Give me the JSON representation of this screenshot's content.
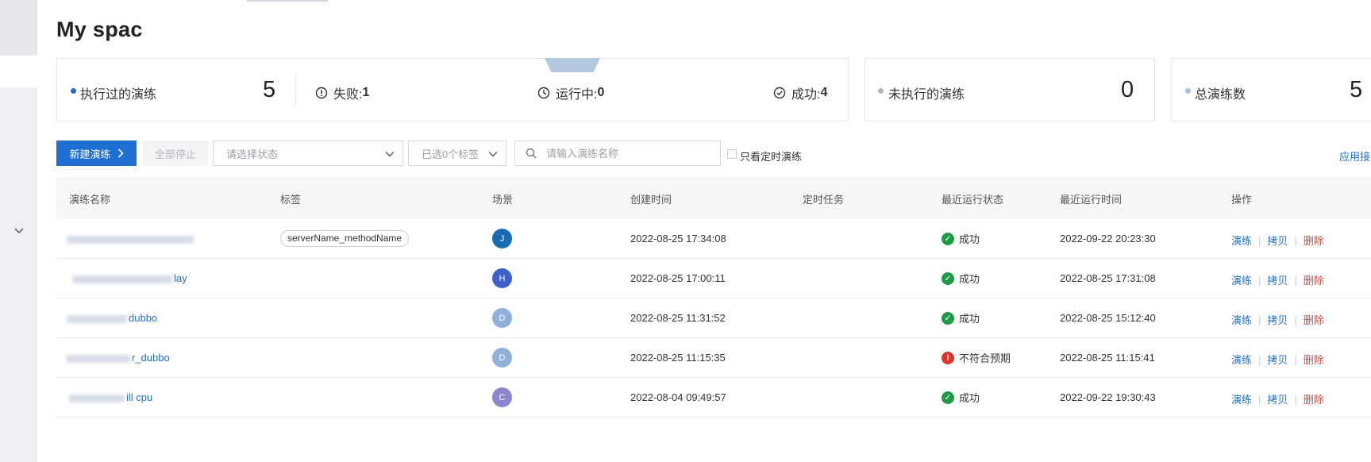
{
  "page": {
    "title": "My spac"
  },
  "summary": {
    "executed": {
      "label": "执行过的演练",
      "value": "5",
      "dot_color": "#1f6fd1",
      "stats": [
        {
          "icon": "alert-circle-icon",
          "label": "失败:",
          "value": "1"
        },
        {
          "icon": "clock-icon",
          "label": "运行中:",
          "value": "0"
        },
        {
          "icon": "check-circle-icon",
          "label": "成功:",
          "value": "4"
        }
      ]
    },
    "unexecuted": {
      "label": "未执行的演练",
      "value": "0",
      "dot_color": "#b3b6bc"
    },
    "total": {
      "label": "总演练数",
      "value": "5",
      "dot_color": "#a7c0e0"
    }
  },
  "toolbar": {
    "new_button": "新建演练",
    "stop_all_button": "全部停止",
    "status_placeholder": "请选择状态",
    "tags_value": "已选0个标签",
    "search_placeholder": "请输入演练名称",
    "only_scheduled": "只看定时演练",
    "right_link": "应用接入"
  },
  "table": {
    "columns": [
      "演练名称",
      "标签",
      "场景",
      "创建时间",
      "定时任务",
      "最近运行状态",
      "最近运行时间",
      "操作"
    ],
    "actions": {
      "run": "演练",
      "copy": "拷贝",
      "delete": "删除"
    },
    "rows": [
      {
        "name": "",
        "tag": "serverName_methodName",
        "avatar": "J",
        "avatar_color": "#1a6bb5",
        "created": "2022-08-25 17:34:08",
        "schedule": "",
        "status": "成功",
        "status_type": "success",
        "last_run": "2022-09-22 20:23:30"
      },
      {
        "name": "lay",
        "tag": "",
        "avatar": "H",
        "avatar_color": "#3f5fc9",
        "created": "2022-08-25 17:00:11",
        "schedule": "",
        "status": "成功",
        "status_type": "success",
        "last_run": "2022-08-25 17:31:08"
      },
      {
        "name": "dubbo",
        "tag": "",
        "avatar": "D",
        "avatar_color": "#8fb0d8",
        "created": "2022-08-25 11:31:52",
        "schedule": "",
        "status": "成功",
        "status_type": "success",
        "last_run": "2022-08-25 15:12:40"
      },
      {
        "name": "r_dubbo",
        "tag": "",
        "avatar": "D",
        "avatar_color": "#8fb0d8",
        "created": "2022-08-25 11:15:35",
        "schedule": "",
        "status": "不符合预期",
        "status_type": "error",
        "last_run": "2022-08-25 11:15:41"
      },
      {
        "name": "ill cpu",
        "tag": "",
        "avatar": "C",
        "avatar_color": "#8c87cf",
        "created": "2022-08-04 09:49:57",
        "schedule": "",
        "status": "成功",
        "status_type": "success",
        "last_run": "2022-09-22 19:30:43"
      }
    ]
  },
  "colors": {
    "primary": "#1f6fd1",
    "success": "#1e9a45",
    "error": "#e0342b",
    "danger_link": "#e0453a"
  }
}
